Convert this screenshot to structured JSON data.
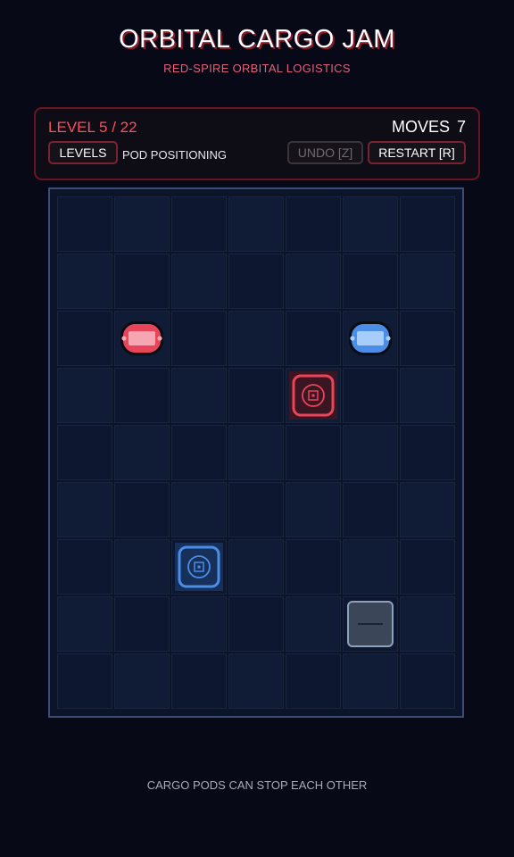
{
  "game": {
    "title": "ORBITAL CARGO JAM",
    "subtitle": "RED-SPIRE ORBITAL LOGISTICS"
  },
  "hud": {
    "level_text": "LEVEL 5 / 22",
    "moves_label": "MOVES",
    "moves_value": "7",
    "levels_button": "LEVELS",
    "mode_label": "POD POSITIONING",
    "undo_button": "UNDO [Z]",
    "restart_button": "RESTART  [R]"
  },
  "board": {
    "columns": 7,
    "rows": 9,
    "red_pod": {
      "col": 1,
      "row": 2
    },
    "blue_pod": {
      "col": 5,
      "row": 2
    },
    "red_target": {
      "col": 4,
      "row": 3
    },
    "blue_target": {
      "col": 2,
      "row": 6
    },
    "blocks": [
      {
        "col": 5,
        "row": 7
      }
    ]
  },
  "colors": {
    "red": "#e8455a",
    "blue": "#4a8ee8"
  },
  "hint": "CARGO PODS CAN STOP EACH OTHER"
}
